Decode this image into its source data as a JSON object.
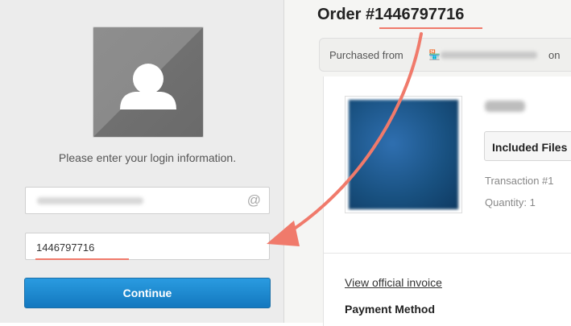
{
  "login": {
    "prompt": "Please enter your login information.",
    "email_icon": "@",
    "order_number_value": "1446797716",
    "continue_label": "Continue"
  },
  "order": {
    "title": "Order #1446797716",
    "purchased_prefix": "Purchased from",
    "purchased_suffix": "on",
    "item": {
      "included_files_label": "Included Files",
      "transaction_label": "Transaction #1",
      "quantity_label": "Quantity: 1"
    },
    "invoice_link": "View official invoice",
    "payment_method_label": "Payment Method"
  },
  "icons": {
    "avatar": "user-silhouette-icon",
    "shop": "shop-icon",
    "arrow": "annotation-arrow-icon"
  },
  "colors": {
    "annotation": "#f07a6b",
    "button": "#1b87d0"
  }
}
